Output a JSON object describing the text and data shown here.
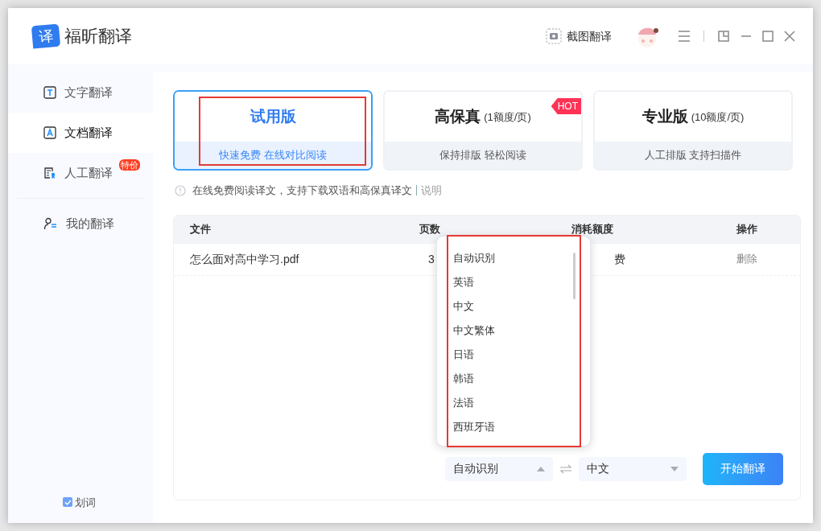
{
  "app": {
    "logo_char": "译",
    "name": "福昕翻译",
    "screenshot_button": "截图翻译"
  },
  "sidebar": {
    "items": [
      {
        "kind": "text",
        "label": "文字翻译",
        "selected": false
      },
      {
        "kind": "doc",
        "label": "文档翻译",
        "selected": true
      },
      {
        "kind": "human",
        "label": "人工翻译",
        "selected": false,
        "badge": "特价"
      },
      {
        "kind": "mine",
        "label": "我的翻译",
        "selected": false
      }
    ],
    "word_pick": {
      "label": "划词",
      "checked": true
    }
  },
  "plans": [
    {
      "title": "试用版",
      "subtitle": "快速免费 在线对比阅读",
      "selected": true,
      "highlighted": true
    },
    {
      "title": "高保真",
      "price": "(1额度/页)",
      "subtitle": "保持排版 轻松阅读",
      "selected": false,
      "badge": "HOT"
    },
    {
      "title": "专业版",
      "price": "(10额度/页)",
      "subtitle": "人工排版 支持扫描件",
      "selected": false
    }
  ],
  "notice": {
    "text": "在线免费阅读译文，支持下载双语和高保真译文",
    "link": "说明"
  },
  "table": {
    "columns": [
      "文件",
      "页数",
      "消耗额度",
      "操作"
    ],
    "rows": [
      {
        "file": "怎么面对高中学习.pdf",
        "pages": "3",
        "cost": "费",
        "action": "删除"
      }
    ]
  },
  "language_menu": {
    "open": true,
    "options": [
      "自动识别",
      "英语",
      "中文",
      "中文繁体",
      "日语",
      "韩语",
      "法语",
      "西班牙语"
    ]
  },
  "source_language": {
    "value": "自动识别",
    "open": true
  },
  "target_language": {
    "value": "中文",
    "open": false
  },
  "start_button": "开始翻译"
}
